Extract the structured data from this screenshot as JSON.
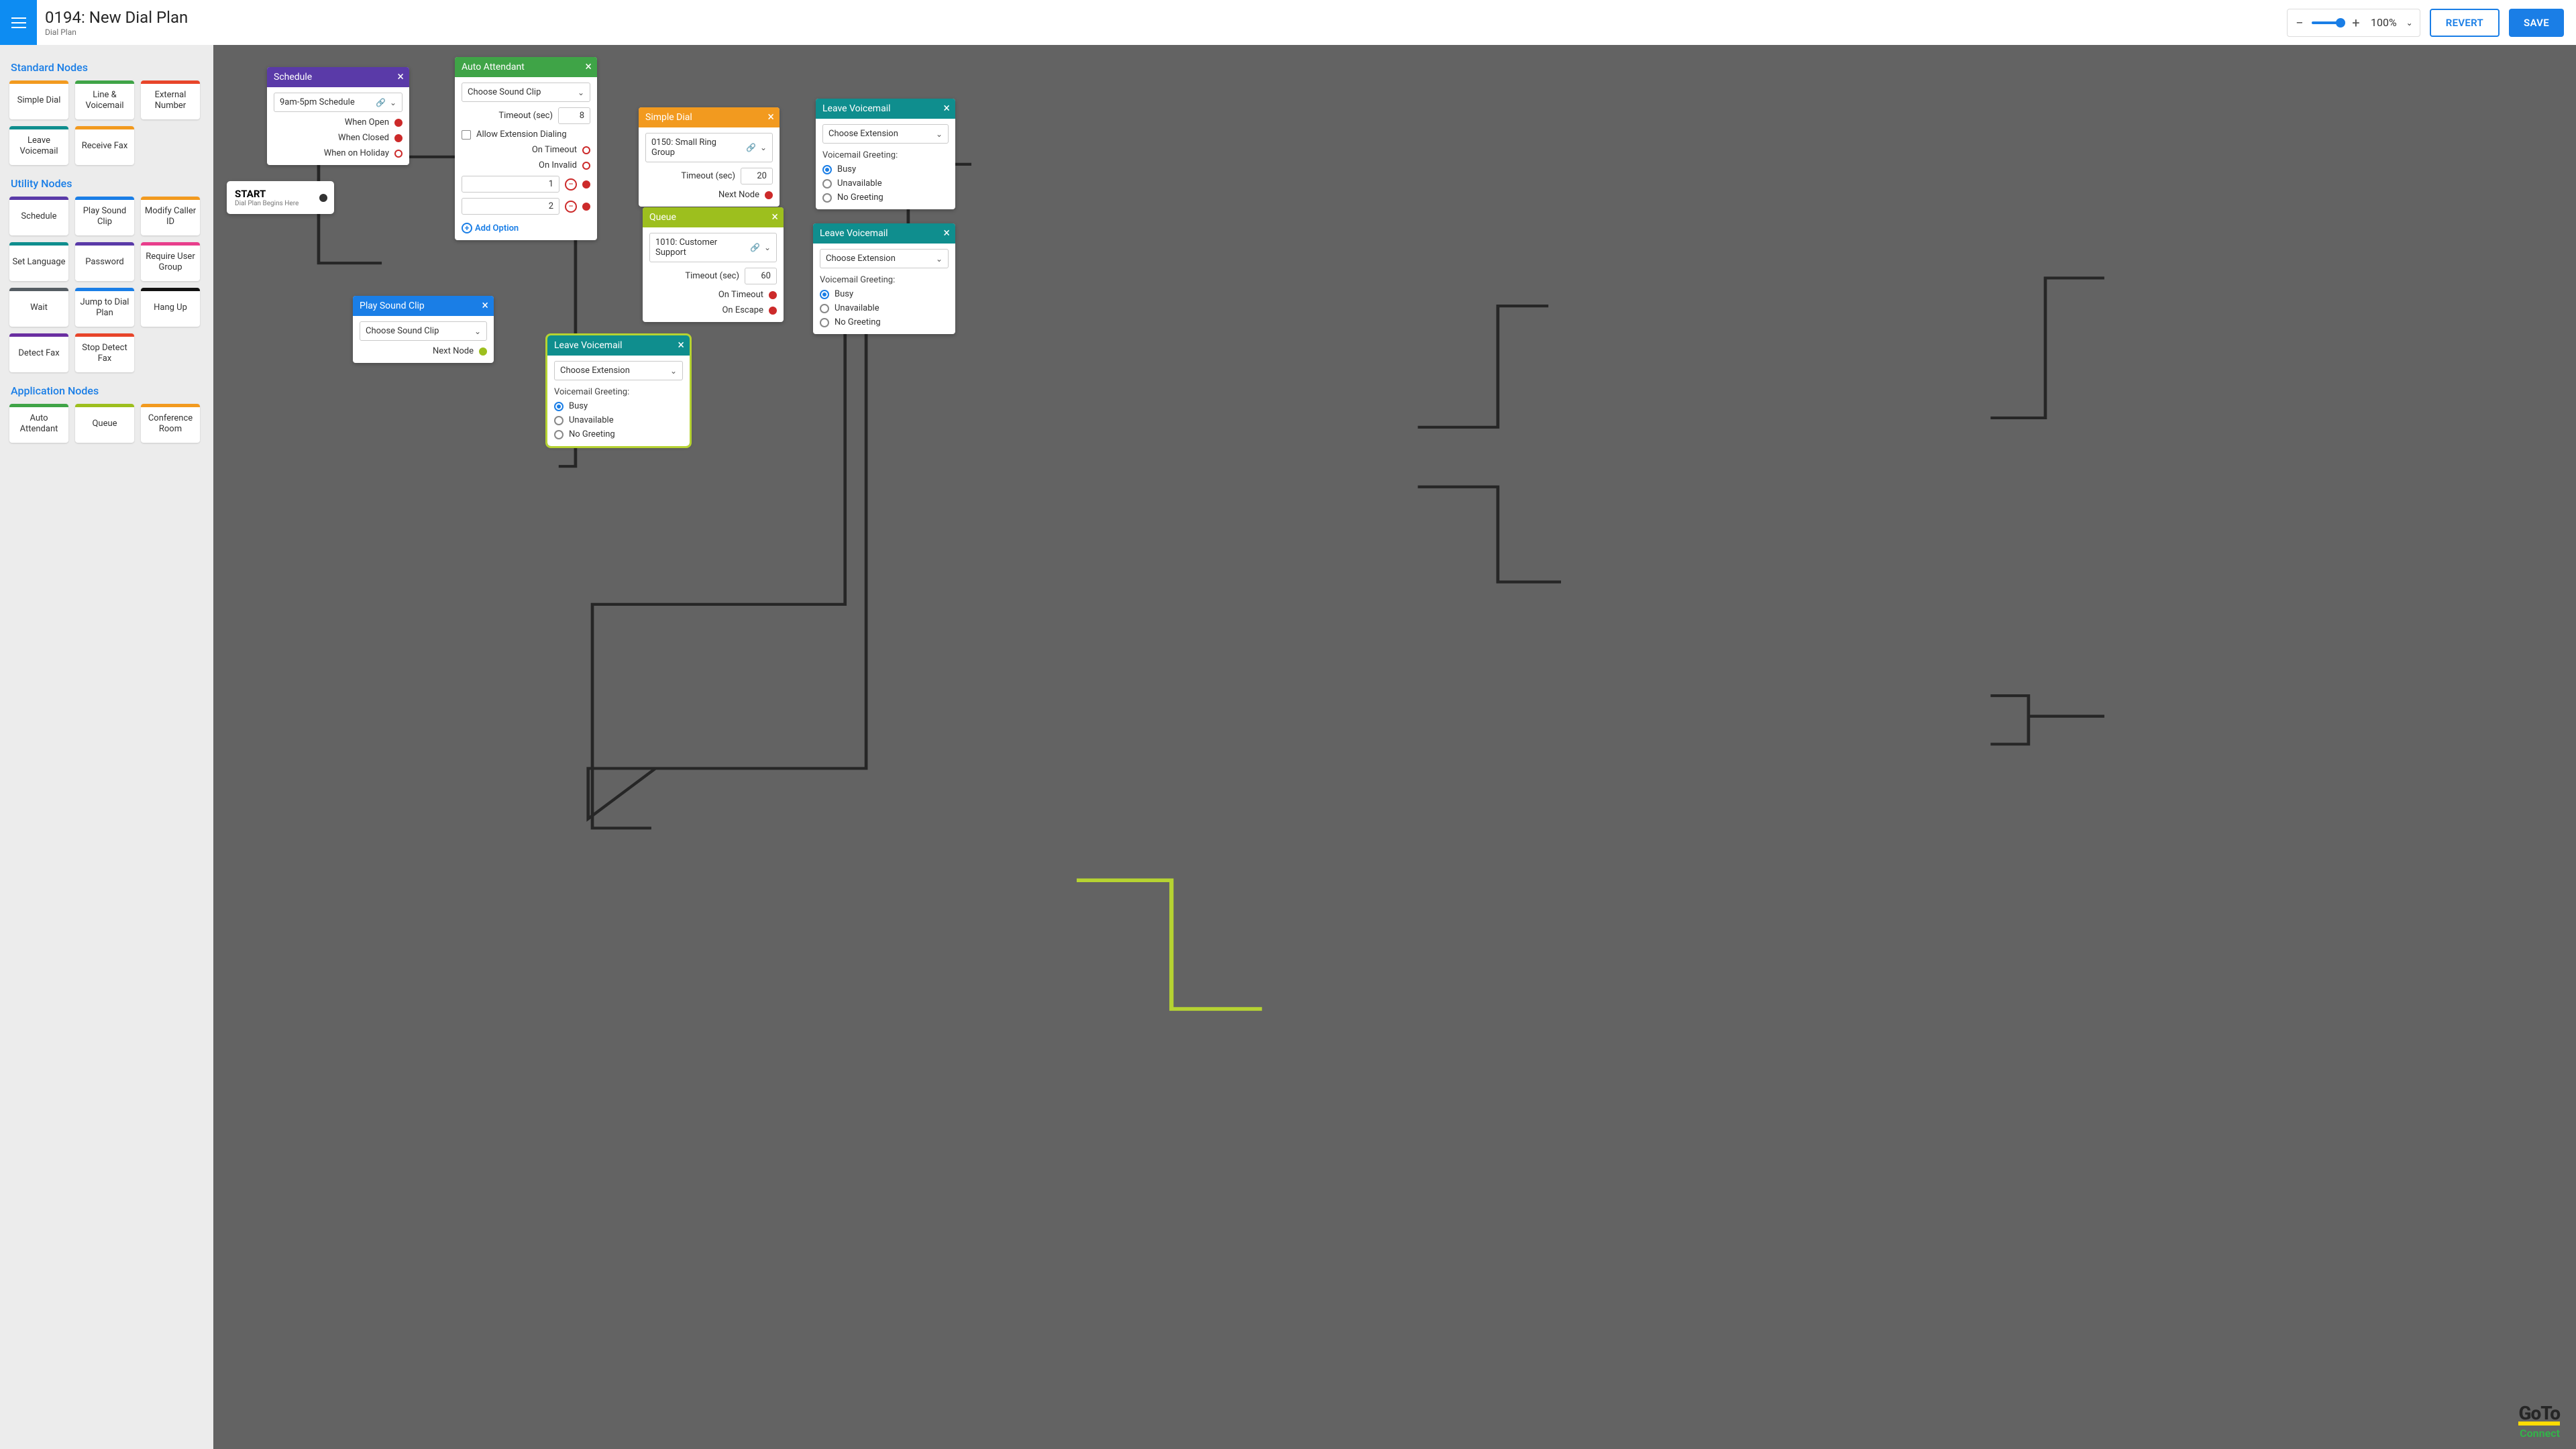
{
  "header": {
    "title": "0194: New Dial Plan",
    "subtitle": "Dial Plan",
    "zoom": "100%",
    "revert": "REVERT",
    "save": "SAVE"
  },
  "palette": {
    "standard": {
      "title": "Standard Nodes",
      "items": [
        "Simple Dial",
        "Line & Voicemail",
        "External Number",
        "Leave Voicemail",
        "Receive Fax"
      ]
    },
    "utility": {
      "title": "Utility Nodes",
      "items": [
        "Schedule",
        "Play Sound Clip",
        "Modify Caller ID",
        "Set Language",
        "Password",
        "Require User Group",
        "Wait",
        "Jump to Dial Plan",
        "Hang Up",
        "Detect Fax",
        "Stop Detect Fax"
      ]
    },
    "app": {
      "title": "Application Nodes",
      "items": [
        "Auto Attendant",
        "Queue",
        "Conference Room"
      ]
    }
  },
  "colors": {
    "standard": [
      "#f29a1f",
      "#3fa447",
      "#e8452a",
      "#0f8e8e",
      "#f29a1f"
    ],
    "utility": [
      "#5a3aa8",
      "#1a7ee6",
      "#f29a1f",
      "#0f8e8e",
      "#5a3aa8",
      "#e83e8c",
      "#555d63",
      "#1a7ee6",
      "#111111",
      "#6a2fa1",
      "#e8452a"
    ],
    "app": [
      "#3fa447",
      "#9dbf1e",
      "#f29a1f"
    ]
  },
  "start": {
    "title": "START",
    "sub": "Dial Plan Begins Here"
  },
  "nodes": {
    "schedule": {
      "title": "Schedule",
      "color": "#5a3aa8",
      "select": "9am-5pm Schedule",
      "outs": [
        "When Open",
        "When Closed",
        "When on Holiday"
      ]
    },
    "auto": {
      "title": "Auto Attendant",
      "color": "#3fa447",
      "select": "Choose Sound Clip",
      "timeout_label": "Timeout (sec)",
      "timeout": "8",
      "allow_ext": "Allow Extension Dialing",
      "on_timeout": "On Timeout",
      "on_invalid": "On Invalid",
      "opt1": "1",
      "opt2": "2",
      "add": "Add Option"
    },
    "simple": {
      "title": "Simple Dial",
      "color": "#f29a1f",
      "select": "0150: Small Ring Group",
      "timeout_label": "Timeout (sec)",
      "timeout": "20",
      "next": "Next Node"
    },
    "queue": {
      "title": "Queue",
      "color": "#9dbf1e",
      "select": "1010: Customer Support",
      "timeout_label": "Timeout (sec)",
      "timeout": "60",
      "on_timeout": "On Timeout",
      "on_escape": "On Escape"
    },
    "play": {
      "title": "Play Sound Clip",
      "color": "#1a7ee6",
      "select": "Choose Sound Clip",
      "next": "Next Node"
    },
    "vm": {
      "title": "Leave Voicemail",
      "color": "#0f8e8e",
      "select": "Choose Extension",
      "greeting_label": "Voicemail Greeting:",
      "opts": [
        "Busy",
        "Unavailable",
        "No Greeting"
      ]
    }
  },
  "logo": {
    "goto": "GoTo",
    "connect": "Connect"
  }
}
